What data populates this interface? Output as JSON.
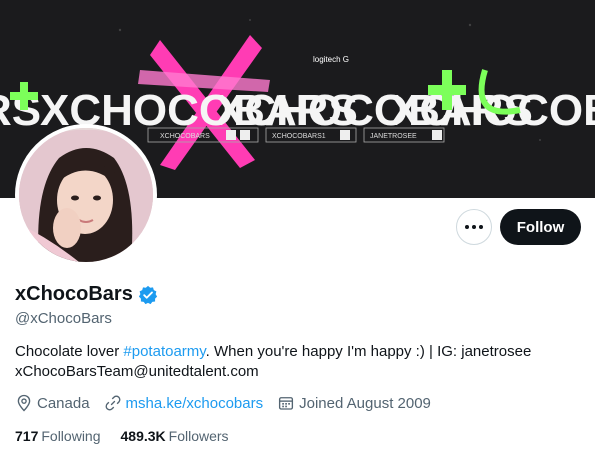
{
  "banner": {
    "brand_text": "logitech G",
    "wordmark": "XCHOCOBARS",
    "tags": [
      "XCHOCOBARS",
      "XCHOCOBARS1",
      "JANETROSEE"
    ]
  },
  "actions": {
    "more_icon": "more-horizontal-icon",
    "follow_label": "Follow"
  },
  "profile": {
    "display_name": "xChocoBars",
    "verified_icon": "verified-badge-icon",
    "handle": "@xChocoBars",
    "bio_part1": "Chocolate lover ",
    "bio_hashtag": "#potatoarmy",
    "bio_part2": ". When you're happy I'm happy :) | IG: janetrosee",
    "bio_line2": "xChocoBarsTeam@unitedtalent.com"
  },
  "meta": {
    "location": "Canada",
    "location_icon": "location-pin-icon",
    "website": "msha.ke/xchocobars",
    "website_icon": "link-icon",
    "joined": "Joined August 2009",
    "joined_icon": "calendar-icon"
  },
  "stats": {
    "following_count": "717",
    "following_label": "Following",
    "followers_count": "489.3K",
    "followers_label": "Followers"
  },
  "colors": {
    "accent": "#1d9bf0",
    "banner_bg": "#1a1a1c",
    "pink": "#ff3cb4",
    "green": "#7cff5a",
    "text_primary": "#0f1419",
    "text_secondary": "#536471"
  }
}
